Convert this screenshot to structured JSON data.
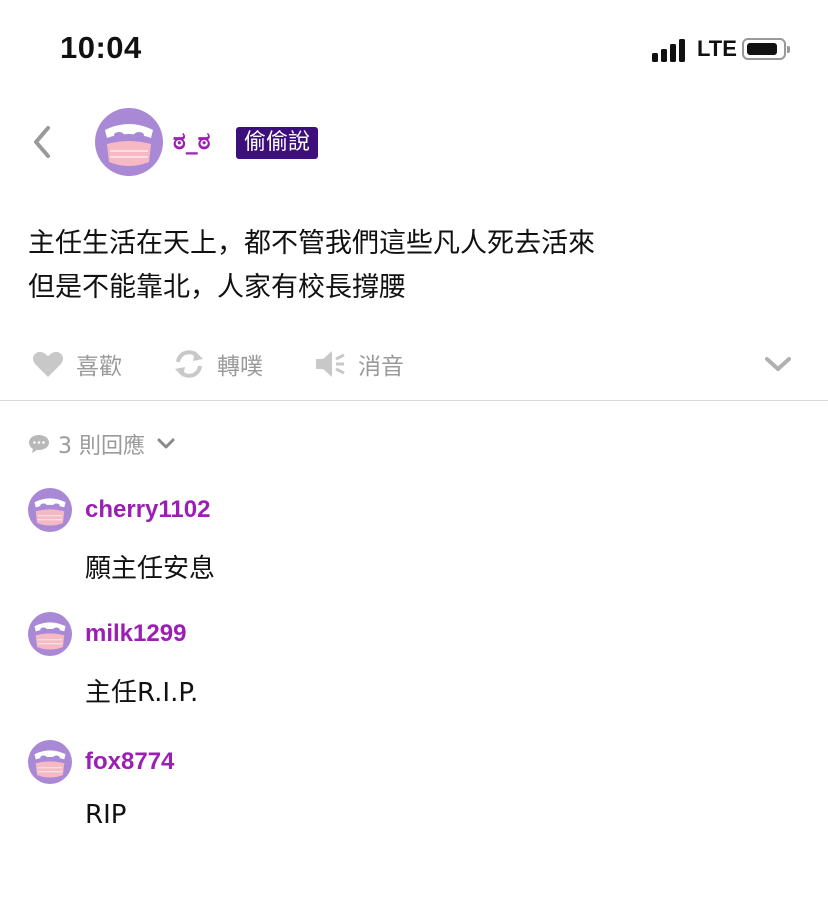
{
  "status_bar": {
    "time": "10:04",
    "network": "LTE"
  },
  "post": {
    "author": "ಠ_ಠ",
    "badge": "偷偷說",
    "body_lines": [
      "主任生活在天上，都不管我們這些凡人死去活來",
      "但是不能靠北，人家有校長撐腰"
    ]
  },
  "actions": {
    "like": "喜歡",
    "repost": "轉噗",
    "mute": "消音"
  },
  "replies": {
    "count_label": "3 則回應",
    "items": [
      {
        "name": "cherry1102",
        "text": "願主任安息"
      },
      {
        "name": "milk1299",
        "text": "主任R.I.P."
      },
      {
        "name": "fox8774",
        "text": "RIP"
      }
    ]
  },
  "icons": {
    "back": "chevron-left-icon",
    "like": "heart-icon",
    "repost": "refresh-icon",
    "mute": "speaker-mute-icon",
    "expand": "chevron-down-icon",
    "comment": "speech-bubble-icon",
    "avatar": "masked-face-icon"
  },
  "colors": {
    "author_purple": "#9b1fb3",
    "badge_bg": "#3d0f7c",
    "avatar_purple": "#a989d6",
    "avatar_mask": "#f6b9c4",
    "action_gray": "#9a9a9a"
  }
}
